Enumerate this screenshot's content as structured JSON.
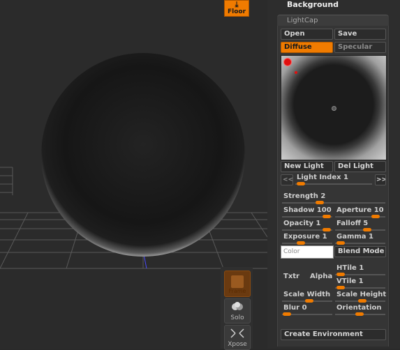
{
  "viewport": {
    "floor_button": "Floor",
    "tools": {
      "frame_label": "Frame",
      "solo_label": "Solo",
      "xpose_label": "Xpose"
    }
  },
  "panel": {
    "section_title": "Background",
    "header": "LightCap",
    "open": "Open",
    "save": "Save",
    "diffuse": "Diffuse",
    "specular": "Specular",
    "new_light": "New Light",
    "del_light": "Del Light",
    "prev": "<<",
    "next": ">>",
    "light_index": "Light Index 1",
    "strength": "Strength 2",
    "shadow": "Shadow 100",
    "aperture": "Aperture 10",
    "opacity": "Opacity 1",
    "falloff": "Falloff 5",
    "exposure": "Exposure 1",
    "gamma": "Gamma 1",
    "color": "Color",
    "blend_mode": "Blend Mode",
    "txtr": "Txtr",
    "alpha": "Alpha",
    "htile": "HTile 1",
    "vtile": "VTile 1",
    "scale_width": "Scale Width",
    "scale_height": "Scale Height",
    "blur": "Blur 0",
    "orientation": "Orientation",
    "create_environment": "Create Environment"
  },
  "colors": {
    "accent": "#f07b00",
    "light_dot": "#e01010"
  }
}
